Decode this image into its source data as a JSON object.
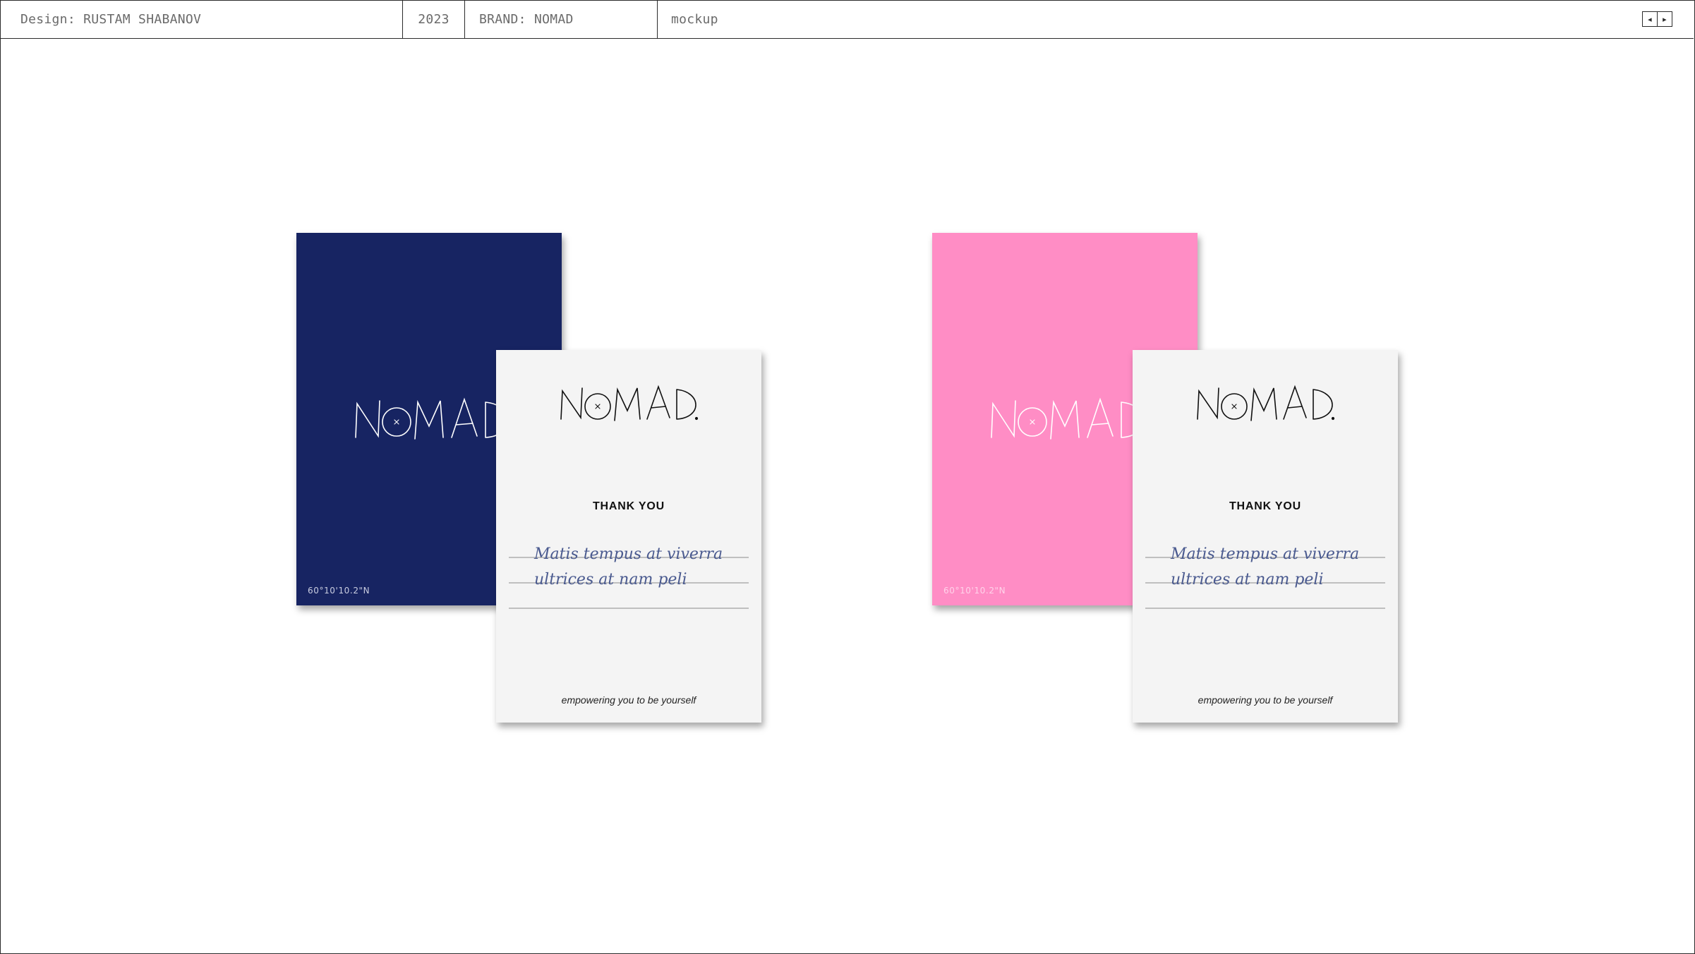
{
  "header": {
    "designer": "Design: RUSTAM SHABANOV",
    "year": "2023",
    "brand": "BRAND: NOMAD",
    "section": "mockup"
  },
  "colors": {
    "navy": "#172462",
    "pink": "#ff8dc5",
    "card": "#f4f4f4",
    "ink": "#4a5a8f"
  },
  "mockups": [
    {
      "back": {
        "color": "navy",
        "logo": "NOMAD.",
        "coords": "60°10'10.2\"N"
      },
      "front": {
        "logo": "NOMAD.",
        "title": "THANK YOU",
        "handwriting": [
          "Matis tempus at viverra",
          "ultrices at nam peli"
        ],
        "tagline": "empowering you to be yourself"
      }
    },
    {
      "back": {
        "color": "pink",
        "logo": "NOMAD.",
        "coords": "60°10'10.2\"N"
      },
      "front": {
        "logo": "NOMAD.",
        "title": "THANK YOU",
        "handwriting": [
          "Matis tempus at viverra",
          "ultrices at nam peli"
        ],
        "tagline": "empowering you to be yourself"
      }
    }
  ]
}
